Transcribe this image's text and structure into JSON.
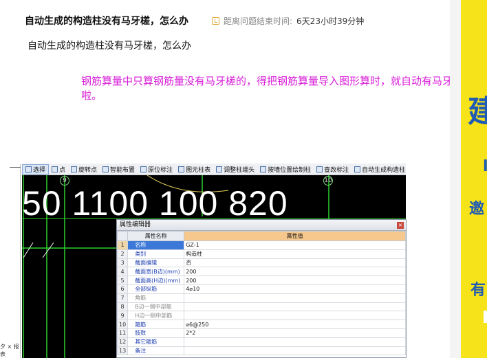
{
  "question": {
    "title": "自动生成的构造柱没有马牙槎，怎么办",
    "meta_label": "距离问题结束时间:",
    "meta_value": "6天23小时39分钟",
    "body": "自动生成的构造柱没有马牙槎，怎么办"
  },
  "answer": {
    "text": "钢筋算量中只算钢筋量没有马牙槎的，得把钢筋算量导入图形算时，就自动有马牙槎啦。",
    "color": "#d81fd8"
  },
  "cad": {
    "toolbar": [
      {
        "label": "选择",
        "icon": "cursor-icon",
        "selected": true
      },
      {
        "label": "点",
        "icon": "point-icon"
      },
      {
        "label": "旋转点",
        "icon": "rotate-icon"
      },
      {
        "label": "智能布置",
        "icon": "smart-layout-icon"
      },
      {
        "label": "原位标注",
        "icon": "annotate-icon"
      },
      {
        "label": "图元柱表",
        "icon": "column-table-icon"
      },
      {
        "label": "调整柱端头",
        "icon": "adjust-end-icon"
      },
      {
        "label": "按墙位置绘制柱",
        "icon": "wall-column-icon"
      },
      {
        "label": "查改标注",
        "icon": "edit-annotation-icon"
      },
      {
        "label": "自动生成构造柱",
        "icon": "auto-generate-icon"
      }
    ],
    "dimensions": "50 1100 100 820",
    "axis_labels": [
      "9",
      "10"
    ],
    "property_editor": {
      "title": "属性编辑器",
      "close": "×",
      "col_name": "属性名称",
      "col_value": "属性值",
      "rows": [
        {
          "no": "1",
          "name": "名称",
          "value": "GZ-1",
          "active": true
        },
        {
          "no": "2",
          "name": "类别",
          "value": "构造柱"
        },
        {
          "no": "3",
          "name": "截面编辑",
          "value": "否"
        },
        {
          "no": "4",
          "name": "截面宽(B边)(mm)",
          "value": "200"
        },
        {
          "no": "5",
          "name": "截面高(H边)(mm)",
          "value": "200"
        },
        {
          "no": "6",
          "name": "全部纵筋",
          "value": "4⌀10"
        },
        {
          "no": "7",
          "name": "角筋",
          "value": "",
          "gray": true
        },
        {
          "no": "8",
          "name": "B边一侧中部筋",
          "value": "",
          "gray": true
        },
        {
          "no": "9",
          "name": "H边一侧中部筋",
          "value": "",
          "gray": true
        },
        {
          "no": "10",
          "name": "箍筋",
          "value": "⌀6@250"
        },
        {
          "no": "11",
          "name": "肢数",
          "value": "2*2"
        },
        {
          "no": "12",
          "name": "其它箍筋",
          "value": ""
        },
        {
          "no": "13",
          "name": "备注",
          "value": ""
        }
      ]
    }
  },
  "left_frame": {
    "bottom_label": "夕 ×  报表"
  },
  "sidebar_ad": {
    "text1": "建",
    "text2": "l",
    "text3": "邀",
    "text4": "有"
  }
}
